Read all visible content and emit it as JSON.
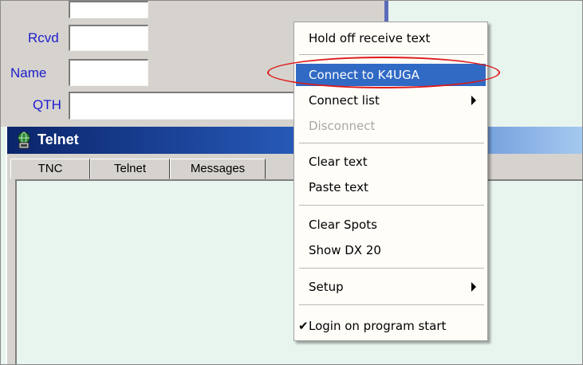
{
  "form": {
    "rcvd_label": "Rcvd",
    "name_label": "Name",
    "qth_label": "QTH"
  },
  "telnet_window": {
    "title": "Telnet",
    "tabs": [
      "TNC",
      "Telnet",
      "Messages"
    ]
  },
  "context_menu": {
    "items": [
      {
        "label": "Hold off receive text"
      },
      {
        "label": "Connect to K4UGA",
        "highlighted": true
      },
      {
        "label": "Connect list",
        "submenu": true
      },
      {
        "label": "Disconnect",
        "disabled": true
      },
      {
        "label": "Clear text"
      },
      {
        "label": "Paste text"
      },
      {
        "label": "Clear Spots"
      },
      {
        "label": "Show DX 20"
      },
      {
        "label": "Setup",
        "submenu": true
      },
      {
        "label": "Login on program start",
        "checked": true
      }
    ]
  },
  "colors": {
    "highlight": "#316ac5",
    "annotation_oval": "#dd1a1a",
    "field_label": "#1c1ccc"
  }
}
